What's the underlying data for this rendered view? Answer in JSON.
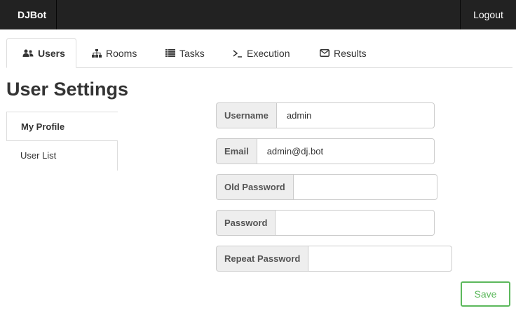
{
  "navbar": {
    "brand": "DJBot",
    "logout_label": "Logout"
  },
  "tabs": [
    {
      "label": "Users",
      "icon": "users-icon",
      "active": true
    },
    {
      "label": "Rooms",
      "icon": "sitemap-icon",
      "active": false
    },
    {
      "label": "Tasks",
      "icon": "list-icon",
      "active": false
    },
    {
      "label": "Execution",
      "icon": "terminal-icon",
      "active": false
    },
    {
      "label": "Results",
      "icon": "envelope-icon",
      "active": false
    }
  ],
  "page_title": "User Settings",
  "subnav": {
    "items": [
      {
        "label": "My Profile",
        "active": true
      },
      {
        "label": "User List",
        "active": false
      }
    ]
  },
  "form": {
    "username": {
      "label": "Username",
      "value": "admin"
    },
    "email": {
      "label": "Email",
      "value": "admin@dj.bot"
    },
    "old_password": {
      "label": "Old Password",
      "value": ""
    },
    "password": {
      "label": "Password",
      "value": ""
    },
    "repeat_password": {
      "label": "Repeat Password",
      "value": ""
    },
    "save_label": "Save"
  },
  "colors": {
    "navbar_bg": "#222222",
    "save_accent": "#5cb85c"
  }
}
